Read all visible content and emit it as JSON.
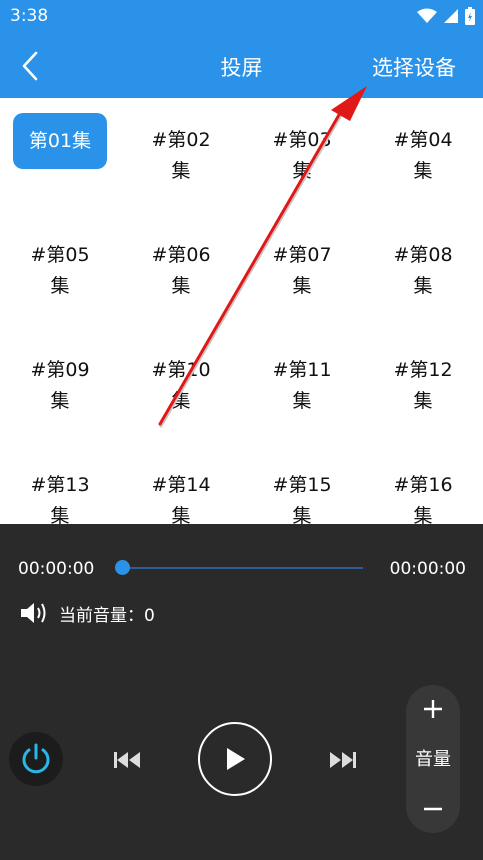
{
  "status_bar": {
    "time": "3:38"
  },
  "app_bar": {
    "title": "投屏",
    "action_label": "选择设备"
  },
  "episodes": [
    {
      "label": "第01集",
      "line1": "第01集",
      "line2": "",
      "selected": true
    },
    {
      "label": "#第02集",
      "line1": "#第02",
      "line2": "集",
      "selected": false
    },
    {
      "label": "#第03集",
      "line1": "#第03",
      "line2": "集",
      "selected": false
    },
    {
      "label": "#第04集",
      "line1": "#第04",
      "line2": "集",
      "selected": false
    },
    {
      "label": "#第05集",
      "line1": "#第05",
      "line2": "集",
      "selected": false
    },
    {
      "label": "#第06集",
      "line1": "#第06",
      "line2": "集",
      "selected": false
    },
    {
      "label": "#第07集",
      "line1": "#第07",
      "line2": "集",
      "selected": false
    },
    {
      "label": "#第08集",
      "line1": "#第08",
      "line2": "集",
      "selected": false
    },
    {
      "label": "#第09集",
      "line1": "#第09",
      "line2": "集",
      "selected": false
    },
    {
      "label": "#第10集",
      "line1": "#第10",
      "line2": "集",
      "selected": false
    },
    {
      "label": "#第11集",
      "line1": "#第11",
      "line2": "集",
      "selected": false
    },
    {
      "label": "#第12集",
      "line1": "#第12",
      "line2": "集",
      "selected": false
    },
    {
      "label": "#第13集",
      "line1": "#第13",
      "line2": "集",
      "selected": false
    },
    {
      "label": "#第14集",
      "line1": "#第14",
      "line2": "集",
      "selected": false
    },
    {
      "label": "#第15集",
      "line1": "#第15",
      "line2": "集",
      "selected": false
    },
    {
      "label": "#第16集",
      "line1": "#第16",
      "line2": "集",
      "selected": false
    }
  ],
  "player": {
    "current_time": "00:00:00",
    "total_time": "00:00:00",
    "progress": 0,
    "volume_text": "当前音量：0",
    "volume_control_label": "音量"
  },
  "colors": {
    "accent": "#2a93e9",
    "player_bg": "#2a2a2a",
    "power_icon": "#29b6e8",
    "annotation_arrow": "#e01818"
  }
}
